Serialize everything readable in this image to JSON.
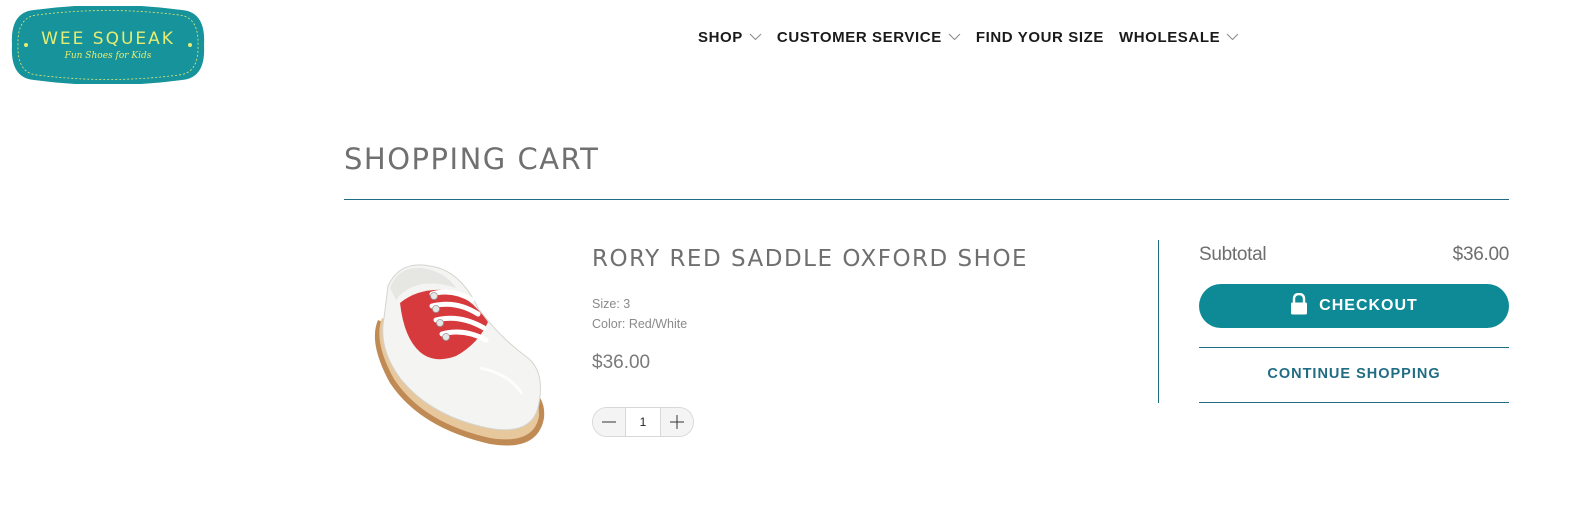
{
  "brand": {
    "name": "WEE SQUEAK",
    "tagline": "Fun Shoes for Kids",
    "colors": {
      "logo_bg": "#17939b",
      "logo_text": "#e6ec73"
    }
  },
  "nav": {
    "items": [
      {
        "label": "SHOP",
        "has_dropdown": true
      },
      {
        "label": "CUSTOMER SERVICE",
        "has_dropdown": true
      },
      {
        "label": "FIND YOUR SIZE",
        "has_dropdown": false
      },
      {
        "label": "WHOLESALE",
        "has_dropdown": true
      }
    ]
  },
  "page": {
    "title": "SHOPPING CART"
  },
  "cart": {
    "items": [
      {
        "title": "RORY RED SADDLE OXFORD SHOE",
        "size": "Size: 3",
        "color": "Color: Red/White",
        "price": "$36.00",
        "quantity": "1",
        "image_icon": "red-white-saddle-shoe"
      }
    ]
  },
  "summary": {
    "subtotal_label": "Subtotal",
    "subtotal_value": "$36.00",
    "checkout_label": "CHECKOUT",
    "continue_label": "CONTINUE SHOPPING",
    "colors": {
      "accent": "#0d8a96",
      "rule": "#1f6c83"
    }
  }
}
